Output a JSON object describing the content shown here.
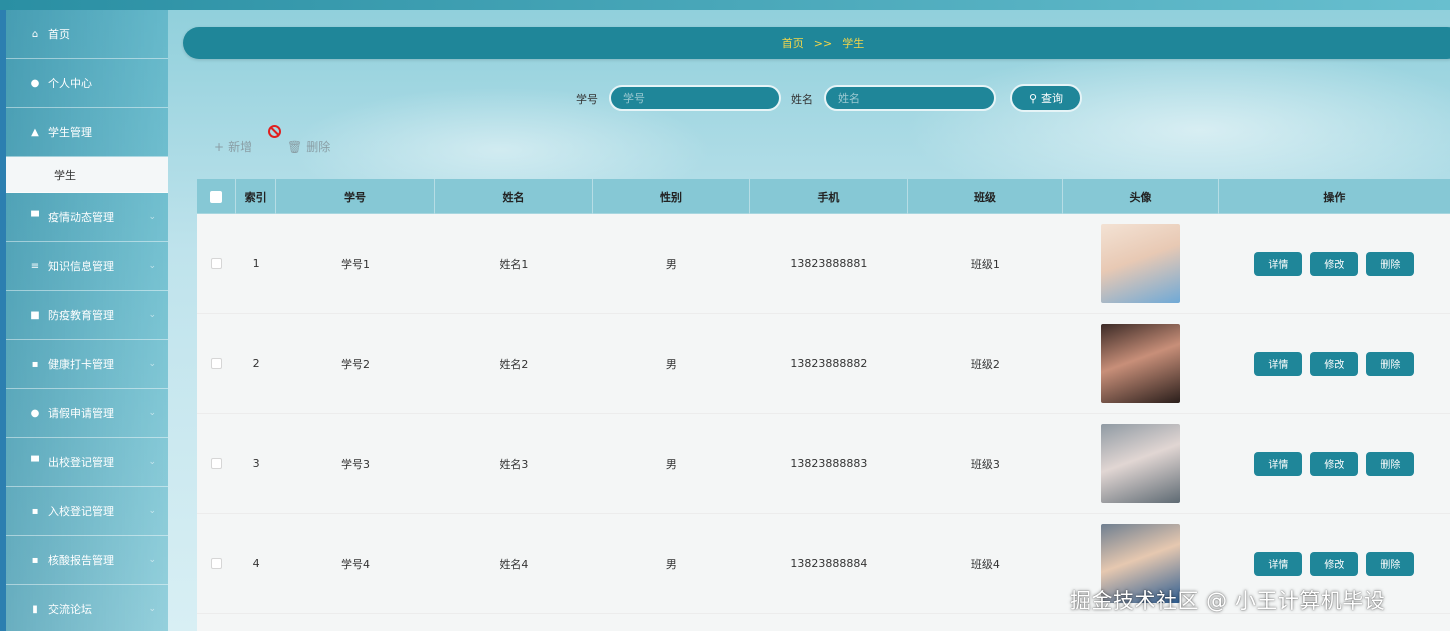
{
  "sidebar": {
    "items": [
      {
        "label": "首页",
        "icon": "home-icon",
        "glyph": "⌂"
      },
      {
        "label": "个人中心",
        "icon": "user-icon",
        "glyph": "●"
      },
      {
        "label": "学生管理",
        "icon": "thumb-icon",
        "glyph": "▲",
        "submenu": [
          "学生"
        ]
      },
      {
        "label": "疫情动态管理",
        "icon": "comment-icon",
        "glyph": "▀"
      },
      {
        "label": "知识信息管理",
        "icon": "list-icon",
        "glyph": "≡"
      },
      {
        "label": "防疫教育管理",
        "icon": "image-icon",
        "glyph": "■"
      },
      {
        "label": "健康打卡管理",
        "icon": "grid-icon",
        "glyph": "▪"
      },
      {
        "label": "请假申请管理",
        "icon": "person-icon",
        "glyph": "●"
      },
      {
        "label": "出校登记管理",
        "icon": "comment-icon",
        "glyph": "▀"
      },
      {
        "label": "入校登记管理",
        "icon": "grid-icon",
        "glyph": "▪"
      },
      {
        "label": "核酸报告管理",
        "icon": "grid-icon",
        "glyph": "▪"
      },
      {
        "label": "交流论坛",
        "icon": "chart-icon",
        "glyph": "▮"
      }
    ]
  },
  "breadcrumb": {
    "home": "首页",
    "separator": ">>",
    "current": "学生"
  },
  "search": {
    "student_id_label": "学号",
    "student_id_placeholder": "学号",
    "name_label": "姓名",
    "name_placeholder": "姓名",
    "button_label": "查询"
  },
  "toolbar": {
    "add_label": "新增",
    "delete_label": "删除"
  },
  "table": {
    "headers": [
      "索引",
      "学号",
      "姓名",
      "性别",
      "手机",
      "班级",
      "头像",
      "操作"
    ],
    "actions": {
      "detail": "详情",
      "edit": "修改",
      "delete": "删除"
    },
    "rows": [
      {
        "index": "1",
        "student_id": "学号1",
        "name": "姓名1",
        "gender": "男",
        "phone": "13823888881",
        "class": "班级1"
      },
      {
        "index": "2",
        "student_id": "学号2",
        "name": "姓名2",
        "gender": "男",
        "phone": "13823888882",
        "class": "班级2"
      },
      {
        "index": "3",
        "student_id": "学号3",
        "name": "姓名3",
        "gender": "男",
        "phone": "13823888883",
        "class": "班级3"
      },
      {
        "index": "4",
        "student_id": "学号4",
        "name": "姓名4",
        "gender": "男",
        "phone": "13823888884",
        "class": "班级4"
      }
    ]
  },
  "watermark": "掘金技术社区 @ 小王计算机毕设",
  "colors": {
    "accent": "#1f8699",
    "breadcrumb_text": "#f3d64a",
    "header": "#86c8d5"
  }
}
